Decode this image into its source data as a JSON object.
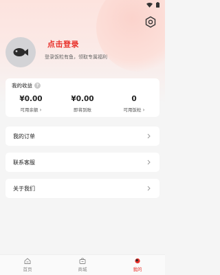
{
  "login": {
    "title": "点击登录",
    "subtitle": "登录饭粒有鱼，领取专属福利"
  },
  "earnings": {
    "title": "我的收益",
    "help_icon": "?",
    "stats": [
      {
        "value": "¥0.00",
        "label": "可用余额"
      },
      {
        "value": "¥0.00",
        "label": "即将到账"
      },
      {
        "value": "0",
        "label": "可用饭粒"
      }
    ]
  },
  "menu": {
    "orders": "我的订单",
    "support": "联系客服",
    "about": "关于我们"
  },
  "tabs": [
    {
      "label": "首页",
      "icon": "home-icon"
    },
    {
      "label": "商城",
      "icon": "shop-bag-icon"
    },
    {
      "label": "我的",
      "icon": "profile-dot-icon"
    }
  ],
  "colors": {
    "accent": "#e8302a",
    "background": "#f5f5f5",
    "avatar": "#d3d3d6"
  }
}
